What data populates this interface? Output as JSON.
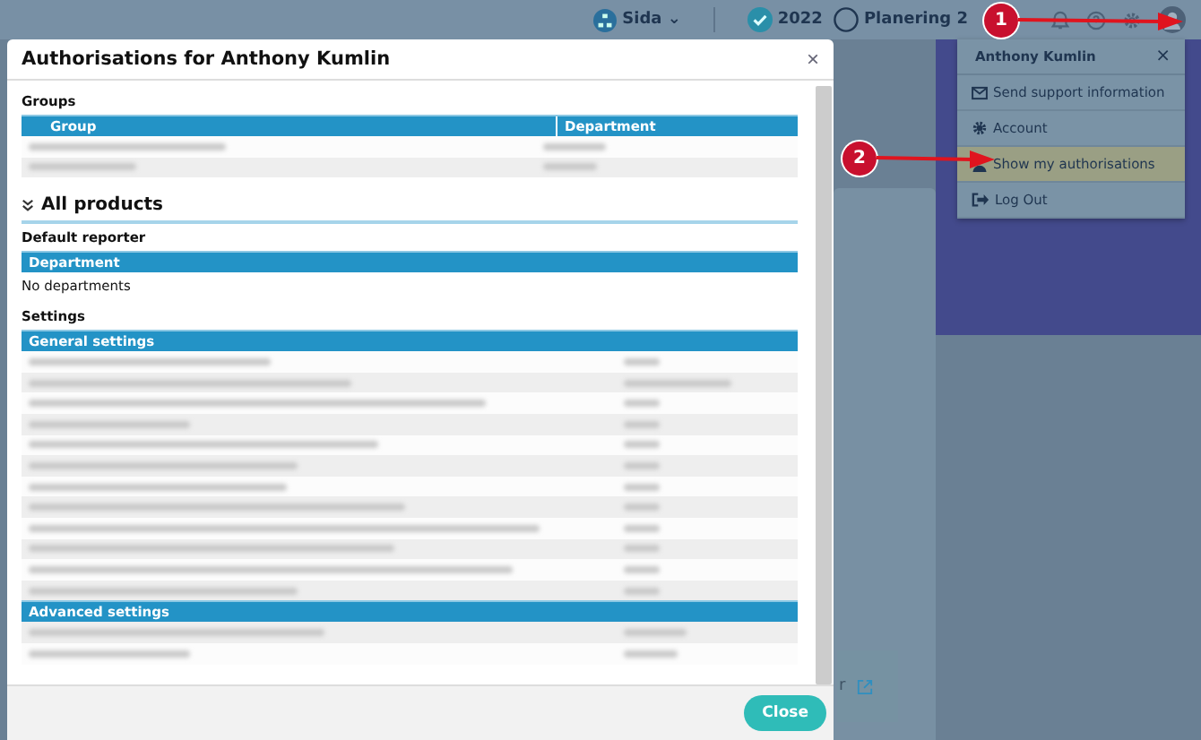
{
  "topbar": {
    "org": "Sida",
    "org_caret": "⌄",
    "year": "2022",
    "year_checked": true,
    "plan": "Planering 2",
    "plan_checked": false,
    "icons": [
      {
        "kind": "bell"
      },
      {
        "kind": "help"
      },
      {
        "kind": "gear"
      },
      {
        "kind": "avatar"
      }
    ]
  },
  "user_menu": {
    "title": "Anthony Kumlin",
    "close": "×",
    "items": [
      {
        "label": "Send support information",
        "selected": false
      },
      {
        "label": "Account",
        "selected": false
      },
      {
        "label": "Show my authorisations",
        "selected": true
      },
      {
        "label": "Log Out",
        "selected": false
      }
    ]
  },
  "callouts": [
    {
      "number": "1"
    },
    {
      "number": "2"
    }
  ],
  "background_link": {
    "text": "r"
  },
  "modal": {
    "title": "Authorisations for Anthony Kumlin",
    "close": "×",
    "groups_heading": "Groups",
    "group_columns": [
      "Group",
      "Department"
    ],
    "group_rows": [
      {
        "shaded": false
      },
      {
        "shaded": true
      }
    ],
    "products_heading": "All products",
    "default_reporter_heading": "Default reporter",
    "department_header": "Department",
    "no_departments": "No departments",
    "settings_heading": "Settings",
    "sections": [
      {
        "title": "General settings",
        "rows": [
          {
            "shaded": false
          },
          {
            "shaded": true
          },
          {
            "shaded": false
          },
          {
            "shaded": true
          },
          {
            "shaded": false
          },
          {
            "shaded": true
          },
          {
            "shaded": false
          },
          {
            "shaded": true
          },
          {
            "shaded": false
          },
          {
            "shaded": true
          },
          {
            "shaded": false
          },
          {
            "shaded": true
          }
        ]
      },
      {
        "title": "Advanced settings",
        "rows": [
          {
            "shaded": true
          },
          {
            "shaded": false
          }
        ]
      }
    ],
    "close_button": "Close"
  }
}
